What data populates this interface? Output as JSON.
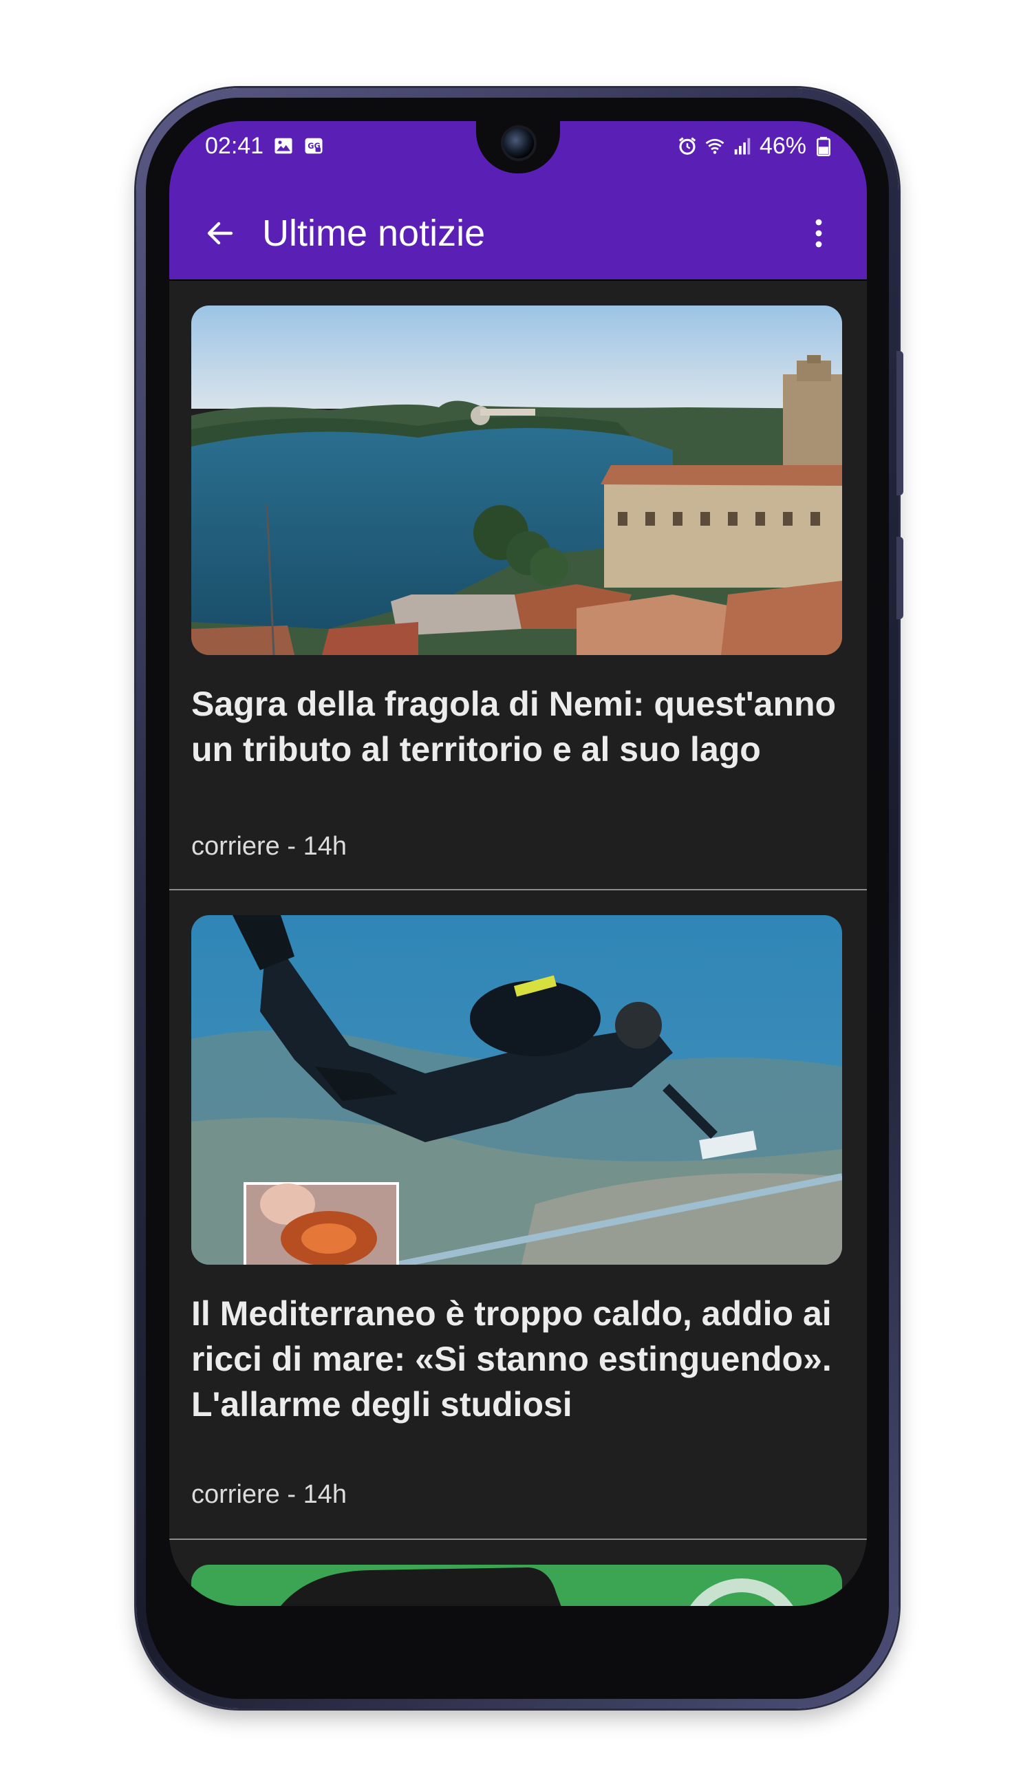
{
  "status_bar": {
    "time": "02:41",
    "battery": "46%",
    "left_icons": [
      "image-icon",
      "cast-icon"
    ],
    "right_icons": [
      "alarm-icon",
      "wifi-icon",
      "signal-icon",
      "battery-icon"
    ]
  },
  "app_bar": {
    "title": "Ultime notizie",
    "back_icon": "back-arrow-icon",
    "menu_icon": "more-vert-icon",
    "color": "#5a20b6"
  },
  "articles": [
    {
      "headline": "Sagra della fragola di Nemi: quest'anno un tributo al territorio e al suo lago",
      "meta": "corriere - 14h",
      "image": "lake-nemi-photo"
    },
    {
      "headline": "Il Mediterraneo è troppo caldo, addio ai ricci di mare: «Si stanno estinguendo». L'allarme degli studiosi",
      "meta": "corriere - 14h",
      "image": "scuba-diver-photo"
    },
    {
      "image": "green-phone-photo"
    }
  ],
  "colors": {
    "background": "#1f1f1f",
    "headline": "#ececec",
    "meta": "#dcdcdc"
  }
}
